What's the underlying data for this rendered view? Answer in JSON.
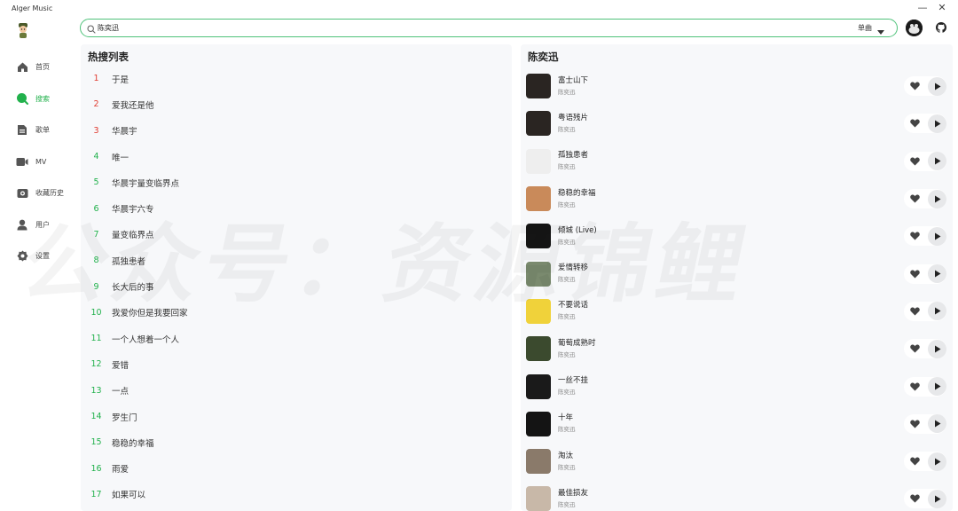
{
  "app": {
    "title": "Alger Music"
  },
  "window": {
    "minimize": "—",
    "close": "✕"
  },
  "sidebar": {
    "items": [
      {
        "label": "首页",
        "icon": "home-icon"
      },
      {
        "label": "搜索",
        "icon": "search-dot-icon",
        "active": true
      },
      {
        "label": "歌单",
        "icon": "playlist-icon"
      },
      {
        "label": "MV",
        "icon": "video-icon"
      },
      {
        "label": "收藏历史",
        "icon": "history-icon"
      },
      {
        "label": "用户",
        "icon": "user-icon"
      },
      {
        "label": "设置",
        "icon": "settings-icon"
      }
    ]
  },
  "search": {
    "value": "陈奕迅",
    "type": "单曲"
  },
  "hot": {
    "title": "热搜列表",
    "items": [
      {
        "rank": "1",
        "text": "于是"
      },
      {
        "rank": "2",
        "text": "爱我还是他"
      },
      {
        "rank": "3",
        "text": "华晨宇"
      },
      {
        "rank": "4",
        "text": "唯一"
      },
      {
        "rank": "5",
        "text": "华晨宇量变临界点"
      },
      {
        "rank": "6",
        "text": "华晨宇六专"
      },
      {
        "rank": "7",
        "text": "量变临界点"
      },
      {
        "rank": "8",
        "text": "孤独患者"
      },
      {
        "rank": "9",
        "text": "长大后的事"
      },
      {
        "rank": "10",
        "text": "我爱你但是我要回家"
      },
      {
        "rank": "11",
        "text": "一个人想着一个人"
      },
      {
        "rank": "12",
        "text": "爱错"
      },
      {
        "rank": "13",
        "text": "一点"
      },
      {
        "rank": "14",
        "text": "罗生门"
      },
      {
        "rank": "15",
        "text": "稳稳的幸福"
      },
      {
        "rank": "16",
        "text": "雨爱"
      },
      {
        "rank": "17",
        "text": "如果可以"
      }
    ]
  },
  "results": {
    "title": "陈奕迅",
    "songs": [
      {
        "name": "富士山下",
        "artist": "陈奕迅",
        "cover": "#2a2522"
      },
      {
        "name": "粤语残片",
        "artist": "陈奕迅",
        "cover": "#2a2522"
      },
      {
        "name": "孤独患者",
        "artist": "陈奕迅",
        "cover": "#eeeeee"
      },
      {
        "name": "稳稳的幸福",
        "artist": "陈奕迅",
        "cover": "#c98a5a"
      },
      {
        "name": "倾城 (Live)",
        "artist": "陈奕迅",
        "cover": "#151515"
      },
      {
        "name": "爱情转移",
        "artist": "陈奕迅",
        "cover": "#7a8a6e"
      },
      {
        "name": "不要说话",
        "artist": "陈奕迅",
        "cover": "#f0d23a"
      },
      {
        "name": "葡萄成熟时",
        "artist": "陈奕迅",
        "cover": "#3b4a2e"
      },
      {
        "name": "一丝不挂",
        "artist": "陈奕迅",
        "cover": "#1a1a1a"
      },
      {
        "name": "十年",
        "artist": "陈奕迅",
        "cover": "#141414"
      },
      {
        "name": "淘汰",
        "artist": "陈奕迅",
        "cover": "#8a7a6a"
      },
      {
        "name": "最佳损友",
        "artist": "陈奕迅",
        "cover": "#c8b8a8"
      }
    ]
  },
  "watermark": "公众号：资源锦鲤",
  "colors": {
    "accent": "#22b14c",
    "rank_top": "#e03c31",
    "panel": "#f7f8fa"
  }
}
